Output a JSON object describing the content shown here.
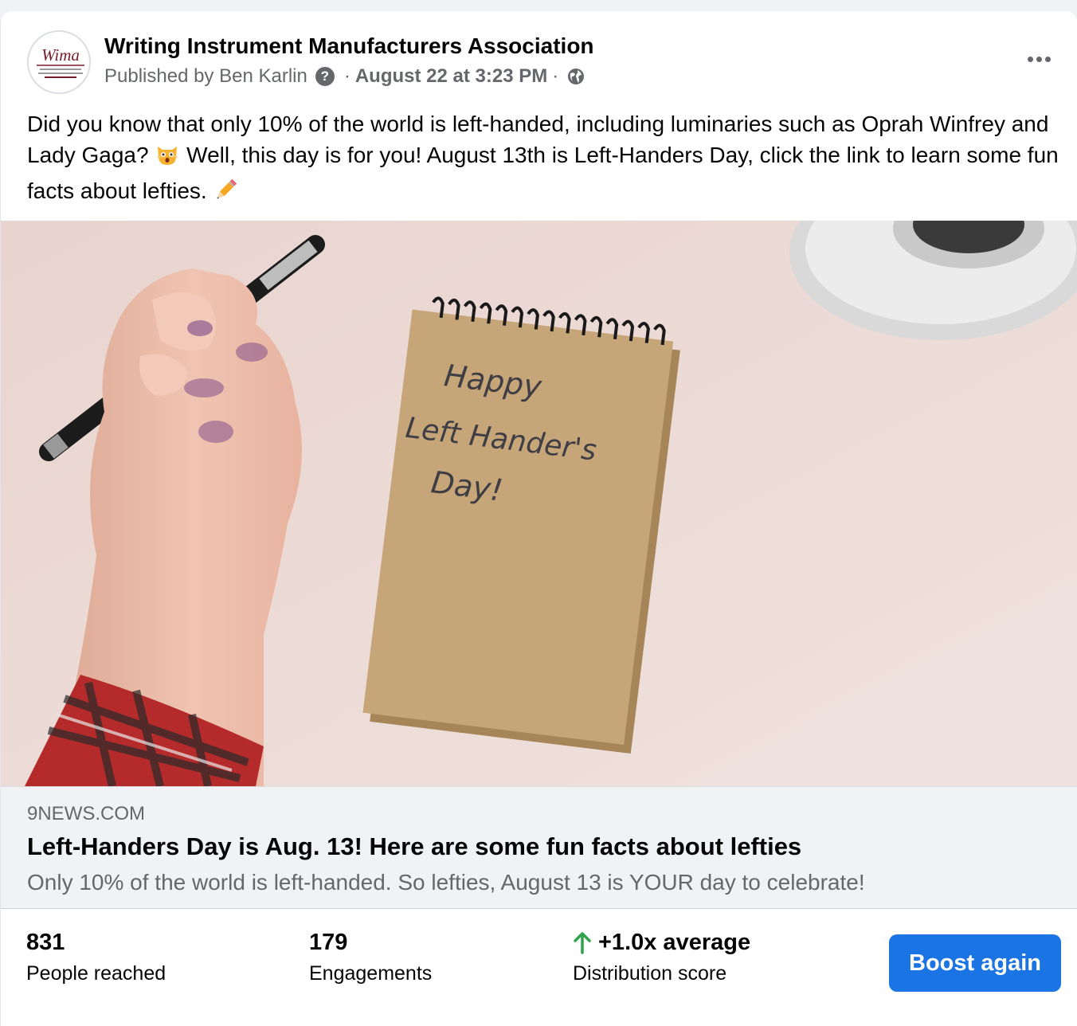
{
  "post": {
    "page_name": "Writing Instrument Manufacturers Association",
    "avatar_text": "Wima",
    "published_by": "Published by Ben Karlin",
    "help_glyph": "?",
    "separator": "·",
    "date": "August 22 at 3:23 PM",
    "audience_icon": "globe-icon",
    "more_icon": "more-options-icon",
    "text_part1": "Did you know that only 10% of the world is left-handed, including luminaries such as Oprah Winfrey and Lady Gaga?",
    "text_part2": "Well, this day is for you! August 13th is Left-Handers Day, click the link to learn some fun facts about lefties."
  },
  "photo": {
    "notebook_line1": "Happy",
    "notebook_line2": "Left Hander's",
    "notebook_line3": "Day!"
  },
  "link": {
    "domain": "9NEWS.COM",
    "title": "Left-Handers Day is Aug. 13! Here are some fun facts about lefties",
    "description": "Only 10% of the world is left-handed. So lefties, August 13 is YOUR day to celebrate!"
  },
  "stats": {
    "reached_value": "831",
    "reached_label": "People reached",
    "engagements_value": "179",
    "engagements_label": "Engagements",
    "distribution_value": "+1.0x average",
    "distribution_label": "Distribution score",
    "trend_color": "#31a24c",
    "boost_label": "Boost again",
    "boost_color": "#1b74e4"
  }
}
